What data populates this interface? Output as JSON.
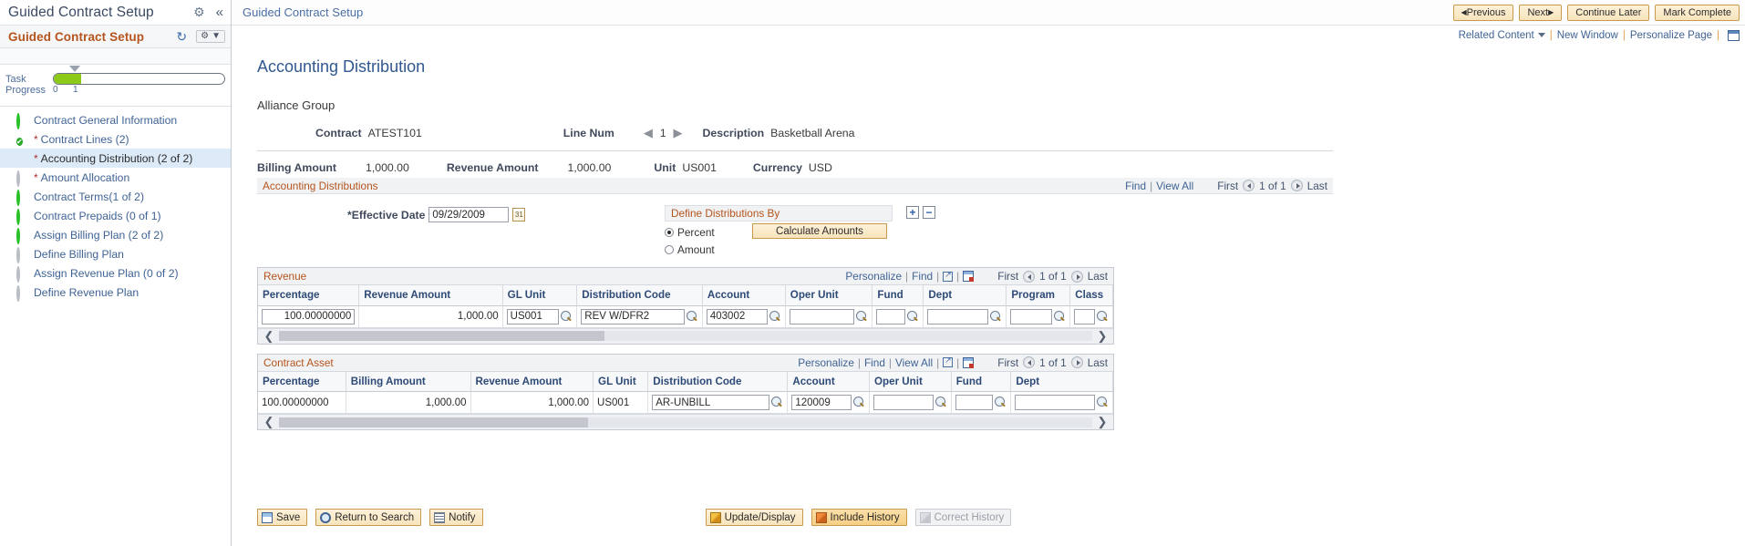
{
  "sidebar": {
    "app_title": "Guided Contract Setup",
    "gear_icon": "gear-icon",
    "collapse_icon": "chevron-double-left-icon",
    "section_title": "Guided Contract Setup",
    "refresh_icon": "refresh-icon",
    "progress": {
      "label_line1": "Task",
      "label_line2": "Progress",
      "tick_min": "0",
      "tick_max": "1",
      "fill_percent": 16
    },
    "items": [
      {
        "label": "Contract General Information",
        "status": "open",
        "required": false,
        "active": false
      },
      {
        "label": "Contract Lines (2)",
        "status": "done",
        "required": true,
        "active": false
      },
      {
        "label": "Accounting Distribution (2 of 2)",
        "status": "half",
        "required": true,
        "active": true
      },
      {
        "label": "Amount Allocation",
        "status": "gray",
        "required": true,
        "active": false
      },
      {
        "label": "Contract Terms(1 of 2)",
        "status": "open",
        "required": false,
        "active": false
      },
      {
        "label": "Contract Prepaids (0 of 1)",
        "status": "open",
        "required": false,
        "active": false
      },
      {
        "label": "Assign Billing Plan (2 of 2)",
        "status": "open",
        "required": false,
        "active": false
      },
      {
        "label": "Define Billing Plan",
        "status": "gray",
        "required": false,
        "active": false
      },
      {
        "label": "Assign Revenue Plan (0 of 2)",
        "status": "gray",
        "required": false,
        "active": false
      },
      {
        "label": "Define Revenue Plan",
        "status": "gray",
        "required": false,
        "active": false
      }
    ]
  },
  "header": {
    "breadcrumb": "Guided Contract Setup",
    "buttons": [
      {
        "label": "Previous",
        "arrow": "left"
      },
      {
        "label": "Next",
        "arrow": "right"
      },
      {
        "label": "Continue Later",
        "arrow": "none"
      },
      {
        "label": "Mark Complete",
        "arrow": "none"
      }
    ],
    "links": {
      "related_content": "Related Content",
      "new_window": "New Window",
      "personalize_page": "Personalize Page",
      "grid_icon": "page-layout-icon"
    }
  },
  "page": {
    "title": "Accounting Distribution",
    "group_name": "Alliance Group",
    "contract_label": "Contract",
    "contract_value": "ATEST101",
    "line_num_label": "Line Num",
    "line_num_value": "1",
    "description_label": "Description",
    "description_value": "Basketball Arena",
    "billing_amount_label": "Billing Amount",
    "billing_amount_value": "1,000.00",
    "revenue_amount_label": "Revenue Amount",
    "revenue_amount_value": "1,000.00",
    "unit_label": "Unit",
    "unit_value": "US001",
    "currency_label": "Currency",
    "currency_value": "USD"
  },
  "acct_dist_bar": {
    "title": "Accounting Distributions",
    "find": "Find",
    "view_all": "View All",
    "first": "First",
    "counter": "1 of 1",
    "last": "Last"
  },
  "effective": {
    "label": "*Effective Date",
    "value": "09/29/2009",
    "calendar_icon": "calendar-icon"
  },
  "define_by": {
    "title": "Define Distributions By",
    "option_percent": "Percent",
    "option_amount": "Amount",
    "selected": "Percent",
    "calculate_button": "Calculate Amounts",
    "add_row": "+",
    "delete_row": "−"
  },
  "revenue_grid": {
    "title": "Revenue",
    "personalize": "Personalize",
    "find": "Find",
    "popout_icon": "popout-icon",
    "export_icon": "export-to-excel-icon",
    "first": "First",
    "counter": "1 of 1",
    "last": "Last",
    "columns": [
      "Percentage",
      "Revenue Amount",
      "GL Unit",
      "Distribution Code",
      "Account",
      "Oper Unit",
      "Fund",
      "Dept",
      "Program",
      "Class"
    ],
    "rows": [
      {
        "percentage": "100.00000000",
        "revenue_amount": "1,000.00",
        "gl_unit": "US001",
        "distribution_code": "REV W/DFR2",
        "account": "403002",
        "oper_unit": "",
        "fund": "",
        "dept": "",
        "program": "",
        "class": ""
      }
    ],
    "scroll_thumb_percent": 40
  },
  "contract_asset_grid": {
    "title": "Contract Asset",
    "personalize": "Personalize",
    "find": "Find",
    "view_all": "View All",
    "popout_icon": "popout-icon",
    "export_icon": "export-to-excel-icon",
    "first": "First",
    "counter": "1 of 1",
    "last": "Last",
    "columns": [
      "Percentage",
      "Billing Amount",
      "Revenue Amount",
      "GL Unit",
      "Distribution Code",
      "Account",
      "Oper Unit",
      "Fund",
      "Dept"
    ],
    "rows": [
      {
        "percentage": "100.00000000",
        "billing_amount": "1,000.00",
        "revenue_amount": "1,000.00",
        "gl_unit": "US001",
        "distribution_code": "AR-UNBILL",
        "account": "120009",
        "oper_unit": "",
        "fund": "",
        "dept": ""
      }
    ],
    "scroll_thumb_percent": 38
  },
  "footer": {
    "save": "Save",
    "return_to_search": "Return to Search",
    "notify": "Notify",
    "update_display": "Update/Display",
    "include_history": "Include History",
    "correct_history": "Correct History"
  },
  "colors": {
    "accent_orange": "#b5541c",
    "link_blue": "#3f6395",
    "title_blue": "#31588f",
    "button_gold": "#f8e4bc",
    "progress_green": "#8cc919",
    "status_done": "#2aaa2a",
    "status_half": "#f7c21c",
    "required_star": "#b03030"
  }
}
